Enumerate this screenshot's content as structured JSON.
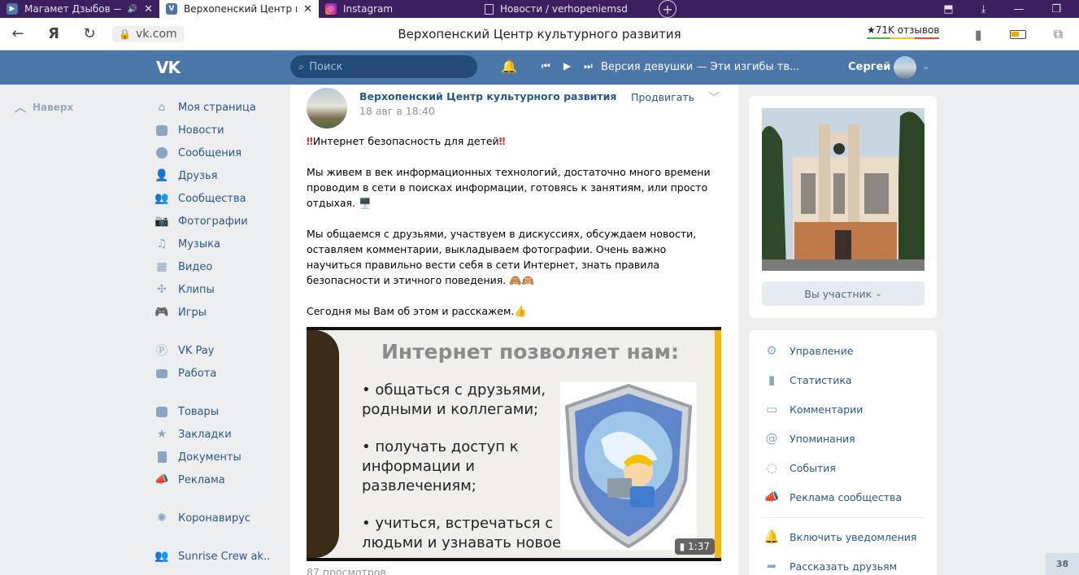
{
  "browser": {
    "tabs": [
      {
        "title": "Магамет Дзыбов — ",
        "favicon": "vk-video-icon"
      },
      {
        "title": "Верхопенский Центр к",
        "favicon": "vk-icon",
        "active": true
      },
      {
        "title": "Instagram",
        "favicon": "instagram-icon"
      },
      {
        "title": "Новости / verhopeniemsd",
        "favicon": "page-icon"
      }
    ],
    "url": "vk.com",
    "page_title": "Верхопенский Центр культурного развития",
    "reviews": "★71K отзывов"
  },
  "header": {
    "logo": "VK",
    "search_placeholder": "Поиск",
    "track": "Версия девушки — Эти изгибы тв...",
    "user_name": "Сергей"
  },
  "left": {
    "up_label": "Наверх",
    "menu": [
      {
        "label": "Моя страница",
        "icon": "home-icon"
      },
      {
        "label": "Новости",
        "icon": "news-icon"
      },
      {
        "label": "Сообщения",
        "icon": "messages-icon"
      },
      {
        "label": "Друзья",
        "icon": "friends-icon"
      },
      {
        "label": "Сообщества",
        "icon": "groups-icon"
      },
      {
        "label": "Фотографии",
        "icon": "camera-icon"
      },
      {
        "label": "Музыка",
        "icon": "music-icon"
      },
      {
        "label": "Видео",
        "icon": "video-icon"
      },
      {
        "label": "Клипы",
        "icon": "clips-icon"
      },
      {
        "label": "Игры",
        "icon": "games-icon"
      },
      {
        "label": "VK Pay",
        "icon": "vkpay-icon"
      },
      {
        "label": "Работа",
        "icon": "briefcase-icon"
      },
      {
        "label": "Товары",
        "icon": "bag-icon"
      },
      {
        "label": "Закладки",
        "icon": "star-icon"
      },
      {
        "label": "Документы",
        "icon": "document-icon"
      },
      {
        "label": "Реклама",
        "icon": "megaphone-icon"
      },
      {
        "label": "Коронавирус",
        "icon": "virus-icon"
      },
      {
        "label": "Sunrise Crew ak..",
        "icon": "community-icon"
      }
    ]
  },
  "post": {
    "author": "Верхопенский Центр культурного развития",
    "date": "18 авг в 18:40",
    "promote": "Продвигать",
    "title": "Интернет безопасность для детей",
    "p1": "Мы живем в век информационных технологий, достаточно много времени проводим в сети в поисках информации, готовясь к занятиям, или просто отдыхая. 🖥️",
    "p2": "Мы общаемся с друзьями, участвуем в дискуссиях, обсуждаем новости, оставляем комментарии, выкладываем фотографии. Очень важно научиться правильно вести себя в сети Интернет, знать правила безопасности и этичного поведения. 🙈🙉",
    "p3": "Сегодня мы Вам об этом и расскажем.👍",
    "video": {
      "title": "Интернет позволяет нам:",
      "items": [
        "• общаться с друзьями, родными и коллегами;",
        "• получать доступ к информации и развлечениям;",
        "• учиться, встречаться с людьми и узнавать новое."
      ],
      "duration": "1:37"
    },
    "views": "87 просмотров"
  },
  "right": {
    "member_button": "Вы участник",
    "actions": [
      {
        "label": "Управление",
        "icon": "gear-icon"
      },
      {
        "label": "Статистика",
        "icon": "stats-icon"
      },
      {
        "label": "Комментарии",
        "icon": "comment-icon"
      },
      {
        "label": "Упоминания",
        "icon": "at-icon"
      },
      {
        "label": "События",
        "icon": "events-icon"
      },
      {
        "label": "Реклама сообщества",
        "icon": "megaphone-icon"
      },
      {
        "label": "Включить уведомления",
        "icon": "bell-icon"
      },
      {
        "label": "Рассказать друзьям",
        "icon": "share-icon"
      }
    ]
  },
  "chat_counter": "38"
}
